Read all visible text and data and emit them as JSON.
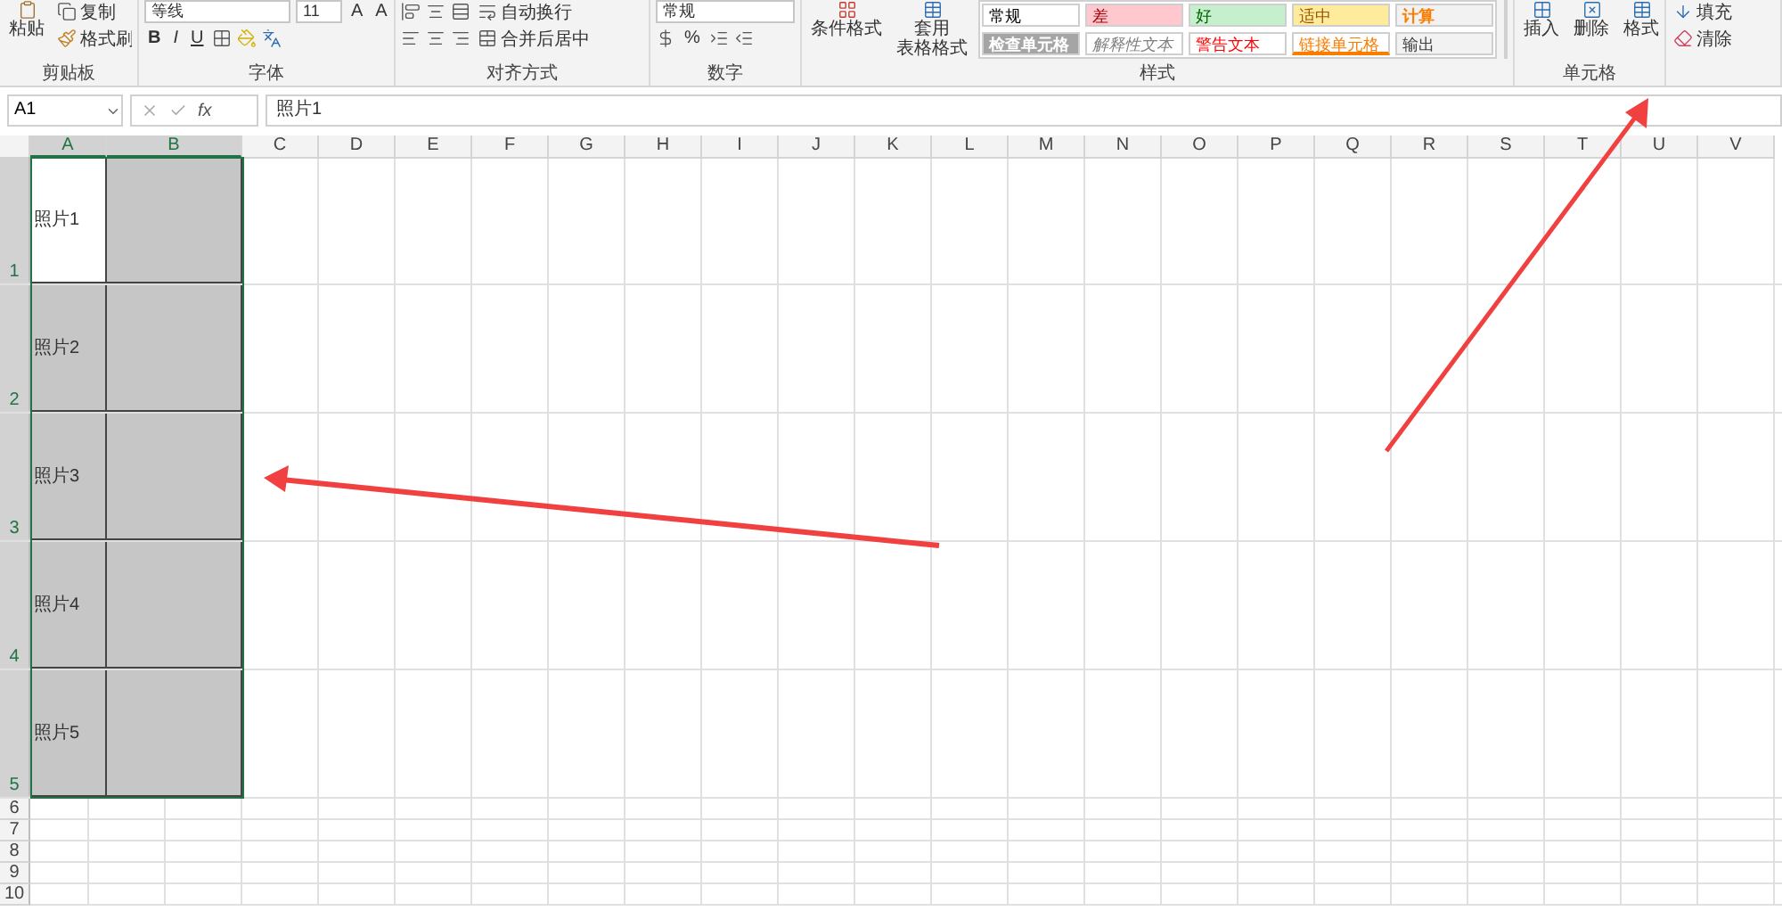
{
  "ribbon": {
    "groups": [
      {
        "kind": "clipboard",
        "label": "剪贴板",
        "paste": "粘贴",
        "copy": "复制",
        "format_painter": "格式刷"
      },
      {
        "kind": "font",
        "label": "字体",
        "font_name": "等线",
        "font_size": "11",
        "grow": "A",
        "shrink": "A",
        "bold": "B",
        "italic": "I",
        "underline": "U"
      },
      {
        "kind": "alignment",
        "label": "对齐方式",
        "wrap_text": "自动换行",
        "merge_center": "合并后居中"
      },
      {
        "kind": "number",
        "label": "数字",
        "format": "常规",
        "percent": "%"
      },
      {
        "kind": "styles",
        "label": "样式",
        "conditional": "条件格式",
        "table_format": [
          "套用",
          "表格格式"
        ],
        "gallery": [
          {
            "text": "常规",
            "kind": "normal"
          },
          {
            "text": "差",
            "kind": "bad"
          },
          {
            "text": "好",
            "kind": "good"
          },
          {
            "text": "适中",
            "kind": "neutral"
          },
          {
            "text": "计算",
            "kind": "calculation"
          },
          {
            "text": "检查单元格",
            "kind": "check"
          },
          {
            "text": "解释性文本",
            "kind": "explanatory"
          },
          {
            "text": "警告文本",
            "kind": "warning"
          },
          {
            "text": "链接单元格",
            "kind": "linked"
          },
          {
            "text": "输出",
            "kind": "output"
          }
        ]
      },
      {
        "kind": "cells",
        "label": "单元格",
        "buttons": [
          "插入",
          "删除",
          "格式"
        ]
      },
      {
        "kind": "editing",
        "fill": "填充",
        "clear": "清除"
      }
    ]
  },
  "formula_bar": {
    "name_box": "A1",
    "function_label": "fx",
    "value": "照片1"
  },
  "sheet": {
    "columns": [
      {
        "label": "A",
        "selected": true
      },
      {
        "label": "B",
        "selected": true
      },
      {
        "label": "C",
        "selected": false
      },
      {
        "label": "D",
        "selected": false
      },
      {
        "label": "E",
        "selected": false
      },
      {
        "label": "F",
        "selected": false
      },
      {
        "label": "G",
        "selected": false
      },
      {
        "label": "H",
        "selected": false
      },
      {
        "label": "I",
        "selected": false
      },
      {
        "label": "J",
        "selected": false
      },
      {
        "label": "K",
        "selected": false
      },
      {
        "label": "L",
        "selected": false
      },
      {
        "label": "M",
        "selected": false
      },
      {
        "label": "N",
        "selected": false
      },
      {
        "label": "O",
        "selected": false
      },
      {
        "label": "P",
        "selected": false
      },
      {
        "label": "Q",
        "selected": false
      },
      {
        "label": "R",
        "selected": false
      },
      {
        "label": "S",
        "selected": false
      },
      {
        "label": "T",
        "selected": false
      },
      {
        "label": "U",
        "selected": false
      },
      {
        "label": "V",
        "selected": false
      }
    ],
    "rows": [
      {
        "label": "1",
        "kind": "tall",
        "selected": true,
        "cell_a": {
          "text": "照片1",
          "active": true
        }
      },
      {
        "label": "2",
        "kind": "tall",
        "selected": true,
        "cell_a": {
          "text": "照片2",
          "active": false
        }
      },
      {
        "label": "3",
        "kind": "tall",
        "selected": true,
        "cell_a": {
          "text": "照片3",
          "active": false
        }
      },
      {
        "label": "4",
        "kind": "tall",
        "selected": true,
        "cell_a": {
          "text": "照片4",
          "active": false
        }
      },
      {
        "label": "5",
        "kind": "tall",
        "selected": true,
        "cell_a": {
          "text": "照片5",
          "active": false
        }
      },
      {
        "label": "6",
        "kind": "short",
        "selected": false
      },
      {
        "label": "7",
        "kind": "short",
        "selected": false
      },
      {
        "label": "8",
        "kind": "short",
        "selected": false
      },
      {
        "label": "9",
        "kind": "short",
        "selected": false
      },
      {
        "label": "10",
        "kind": "short",
        "selected": false
      }
    ]
  }
}
